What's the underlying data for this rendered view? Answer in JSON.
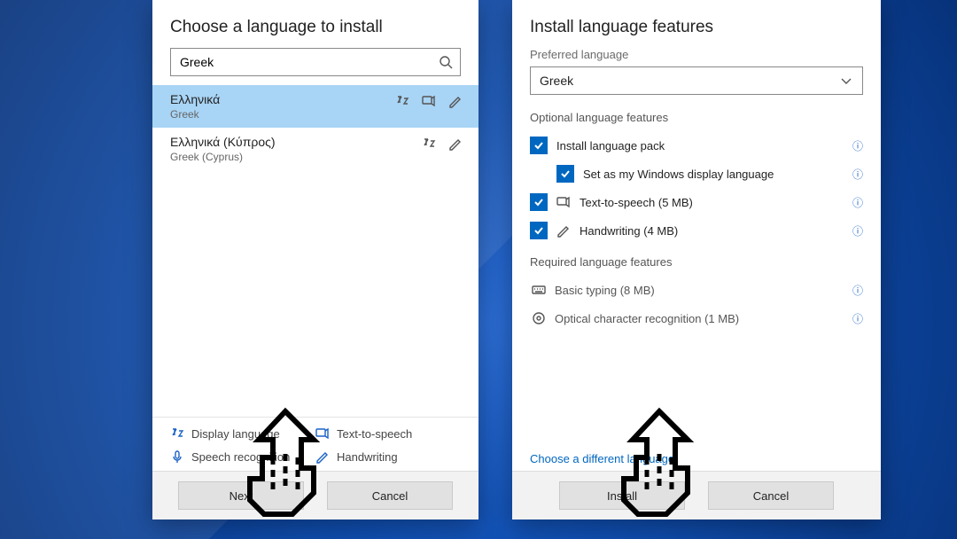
{
  "left": {
    "title": "Choose a language to install",
    "search_value": "Greek",
    "items": [
      {
        "native": "Ελληνικά",
        "english": "Greek",
        "selected": true,
        "icons": [
          "display",
          "tts",
          "handwriting"
        ]
      },
      {
        "native": "Ελληνικά (Κύπρος)",
        "english": "Greek (Cyprus)",
        "selected": false,
        "icons": [
          "display",
          "handwriting"
        ]
      }
    ],
    "legend": {
      "display": "Display language",
      "tts": "Text-to-speech",
      "speech": "Speech recognition",
      "hand": "Handwriting"
    },
    "buttons": {
      "next": "Next",
      "cancel": "Cancel"
    }
  },
  "right": {
    "title": "Install language features",
    "pref_label": "Preferred language",
    "pref_value": "Greek",
    "optional_head": "Optional language features",
    "optional": [
      {
        "key": "pack",
        "label": "Install language pack",
        "checked": true,
        "icon": null
      },
      {
        "key": "setdisp",
        "label": "Set as my Windows display language",
        "checked": true,
        "nested": true
      },
      {
        "key": "tts",
        "label": "Text-to-speech (5 MB)",
        "checked": true,
        "icon": "tts"
      },
      {
        "key": "hand",
        "label": "Handwriting (4 MB)",
        "checked": true,
        "icon": "handwriting"
      }
    ],
    "required_head": "Required language features",
    "required": [
      {
        "label": "Basic typing (8 MB)",
        "icon": "keyboard"
      },
      {
        "label": "Optical character recognition (1 MB)",
        "icon": "ocr"
      }
    ],
    "choose_diff": "Choose a different language",
    "buttons": {
      "install": "Install",
      "cancel": "Cancel"
    }
  }
}
